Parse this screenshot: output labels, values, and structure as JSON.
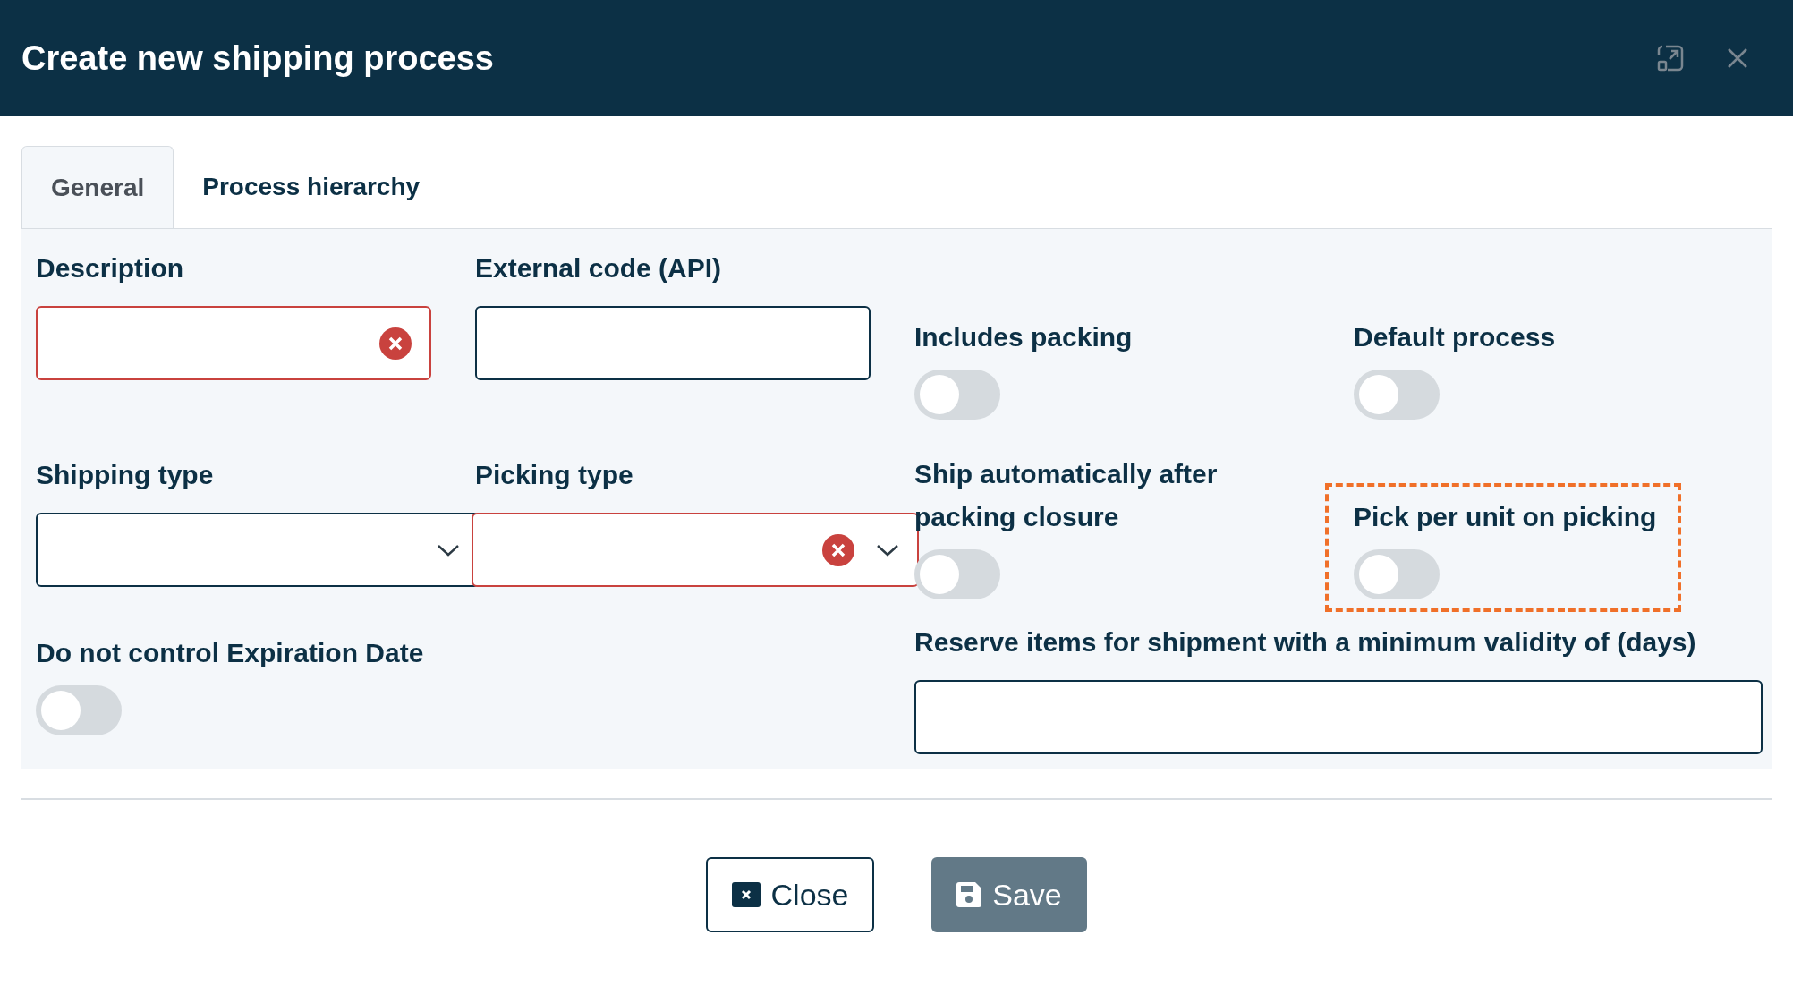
{
  "window": {
    "title": "Create new shipping process"
  },
  "tabs": [
    {
      "label": "General",
      "selected": true
    },
    {
      "label": "Process hierarchy",
      "selected": false
    }
  ],
  "fields": [
    {
      "kind": "text",
      "label": "Description",
      "error": true
    },
    {
      "kind": "text",
      "label": "External code (API)",
      "error": false
    },
    {
      "kind": "toggle",
      "label": "Includes packing",
      "on": false,
      "highlighted": false
    },
    {
      "kind": "toggle",
      "label": "Default process",
      "on": false,
      "highlighted": false
    },
    {
      "kind": "select",
      "label": "Shipping type",
      "error": false
    },
    {
      "kind": "select",
      "label": "Picking type",
      "error": true
    },
    {
      "kind": "toggle",
      "label": "Ship automatically after packing closure",
      "on": false,
      "highlighted": false
    },
    {
      "kind": "toggle",
      "label": "Pick per unit on picking",
      "on": false,
      "highlighted": true
    },
    {
      "kind": "toggle",
      "label": "Do not control Expiration Date",
      "on": false,
      "highlighted": false
    },
    {
      "kind": "wide-text",
      "label": "Reserve items for shipment with a minimum validity of (days)",
      "error": false
    }
  ],
  "buttons": [
    {
      "kind": "close",
      "label": "Close"
    },
    {
      "kind": "save",
      "label": "Save"
    }
  ]
}
